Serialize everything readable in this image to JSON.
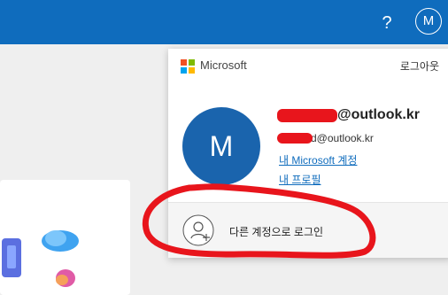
{
  "topbar": {
    "help_label": "?",
    "avatar_initial": "M",
    "color": "#0f6cbd"
  },
  "account_panel": {
    "brand": "Microsoft",
    "sign_out_label": "로그아웃",
    "avatar_initial": "M",
    "display_name": "@outlook.kr",
    "email": "d@outlook.kr",
    "my_account_link": "내 Microsoft 계정",
    "my_profile_link": "내 프로필",
    "sign_in_other_label": "다른 계정으로 로그인",
    "avatar_color": "#1a64ad",
    "link_color": "#0f6cbd"
  },
  "annotations": {
    "redaction_color": "#e8151c",
    "highlight_color": "#e8151c"
  }
}
